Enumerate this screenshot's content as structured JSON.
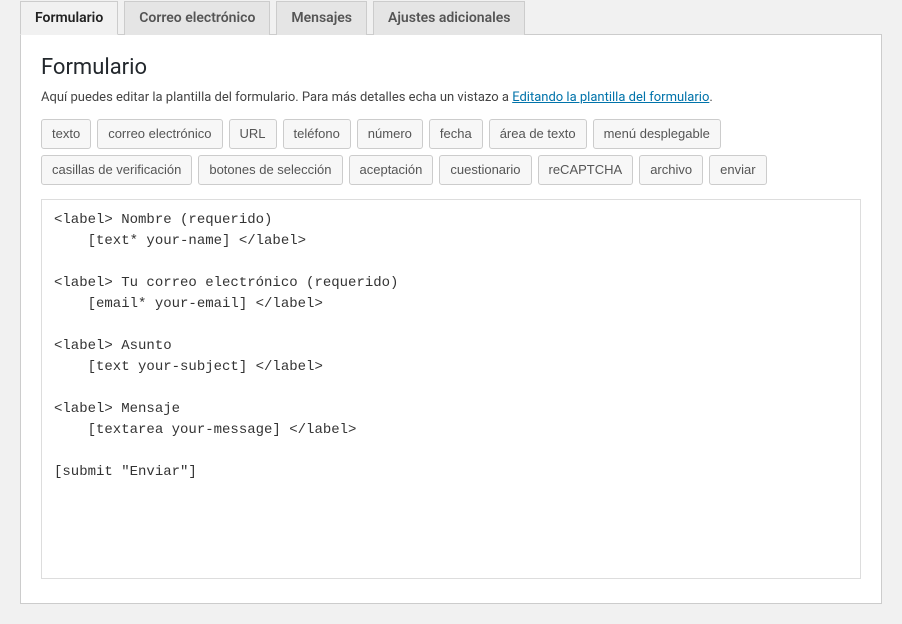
{
  "tabs": {
    "formulario": "Formulario",
    "correo": "Correo electrónico",
    "mensajes": "Mensajes",
    "ajustes": "Ajustes adicionales"
  },
  "panel": {
    "heading": "Formulario",
    "description_prefix": "Aquí puedes editar la plantilla del formulario. Para más detalles echa un vistazo a ",
    "description_link": "Editando la plantilla del formulario",
    "description_suffix": "."
  },
  "tag_buttons": {
    "texto": "texto",
    "correo": "correo electrónico",
    "url": "URL",
    "telefono": "teléfono",
    "numero": "número",
    "fecha": "fecha",
    "area_texto": "área de texto",
    "menu_desplegable": "menú desplegable",
    "casillas": "casillas de verificación",
    "botones_seleccion": "botones de selección",
    "aceptacion": "aceptación",
    "cuestionario": "cuestionario",
    "recaptcha": "reCAPTCHA",
    "archivo": "archivo",
    "enviar": "enviar"
  },
  "editor_content": "<label> Nombre (requerido)\n    [text* your-name] </label>\n\n<label> Tu correo electrónico (requerido)\n    [email* your-email] </label>\n\n<label> Asunto\n    [text your-subject] </label>\n\n<label> Mensaje\n    [textarea your-message] </label>\n\n[submit \"Enviar\"]"
}
